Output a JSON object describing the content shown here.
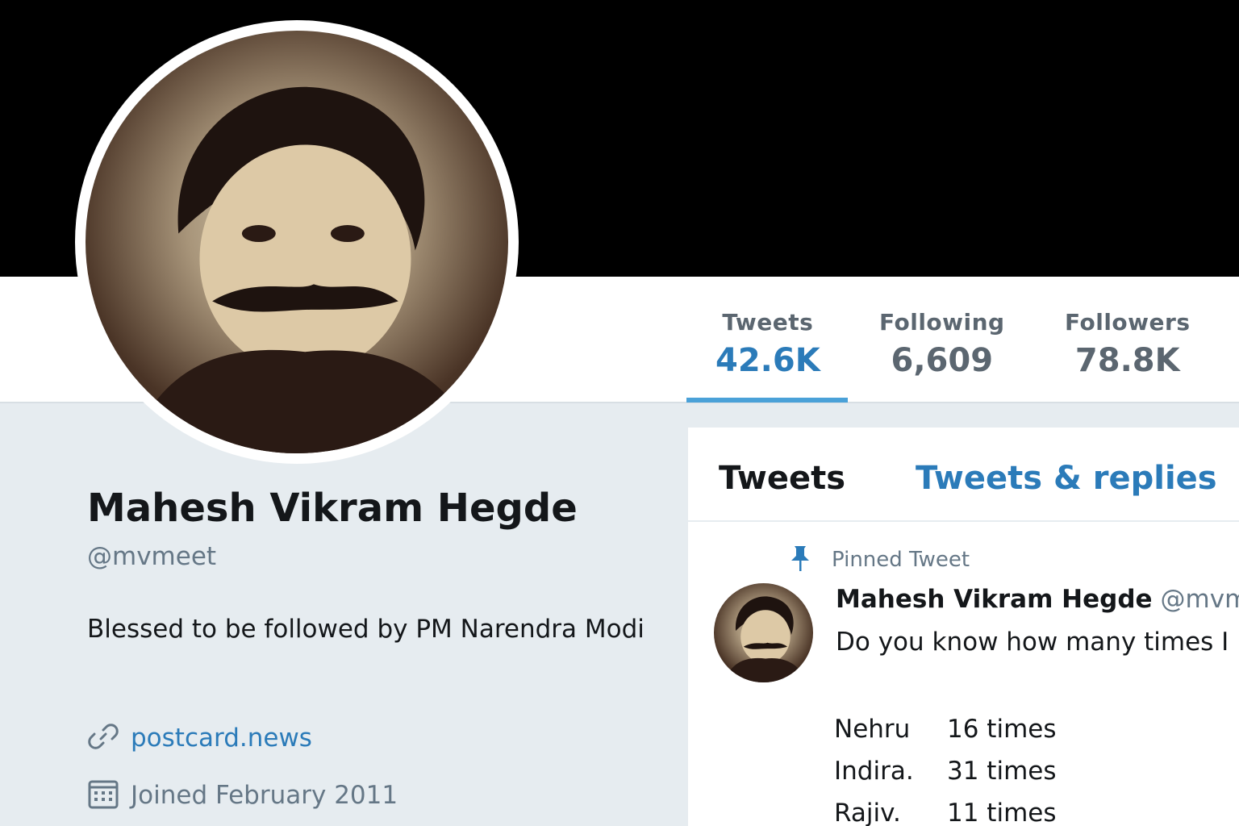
{
  "profile": {
    "name": "Mahesh Vikram Hegde",
    "handle": "@mvmeet",
    "bio": "Blessed to be followed by PM Narendra Modi",
    "link": "postcard.news",
    "joined": "Joined February 2011"
  },
  "stats": [
    {
      "label": "Tweets",
      "value": "42.6K"
    },
    {
      "label": "Following",
      "value": "6,609"
    },
    {
      "label": "Followers",
      "value": "78.8K"
    }
  ],
  "timeline": {
    "tabs": [
      "Tweets",
      "Tweets & replies"
    ],
    "pinned_label": "Pinned Tweet",
    "tweet": {
      "author": "Mahesh Vikram Hegde",
      "handle": "@mvm",
      "body": "Do you know how many times I",
      "rows": [
        {
          "name": "Nehru",
          "value": "16 times"
        },
        {
          "name": "Indira.",
          "value": "31 times"
        },
        {
          "name": "Rajiv.",
          "value": "11 times"
        }
      ]
    }
  },
  "colors": {
    "accent": "#2b7bb9",
    "banner": "#000000",
    "page_background": "#e6ecf0",
    "muted_text": "#657786"
  },
  "icons": [
    "link-icon",
    "calendar-icon",
    "pin-icon"
  ]
}
